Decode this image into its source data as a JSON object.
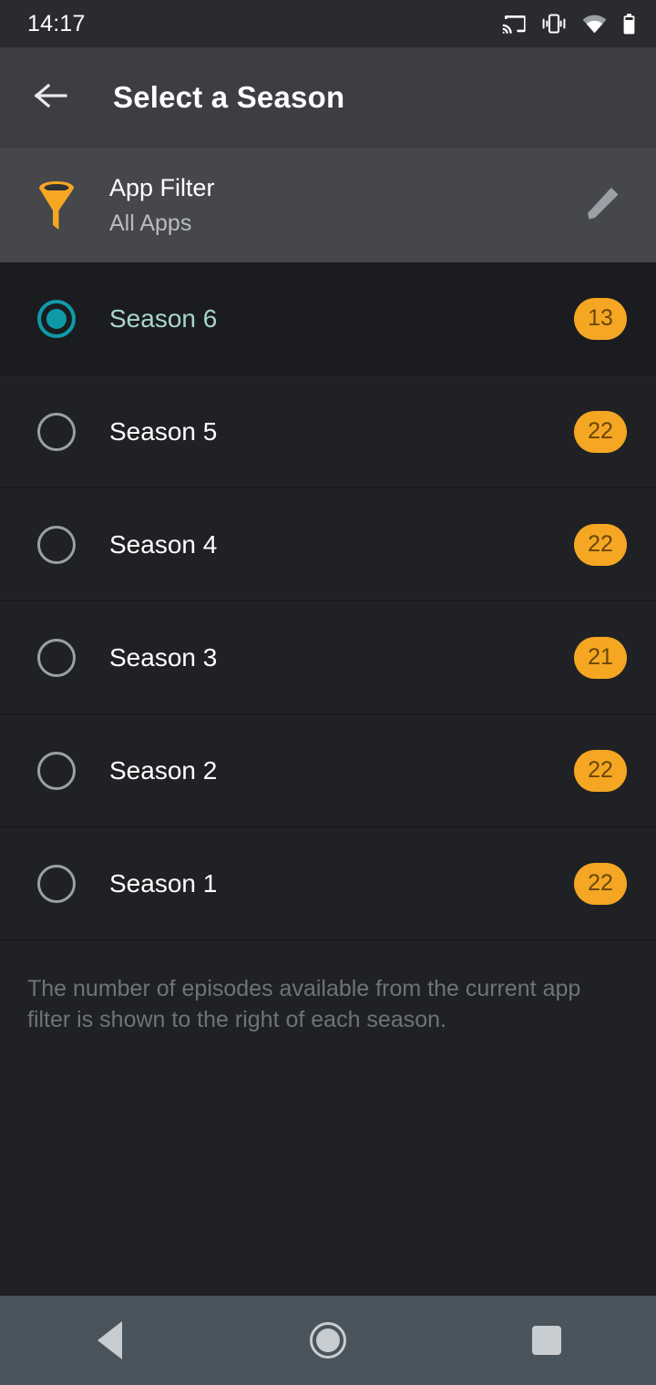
{
  "statusbar": {
    "time": "14:17",
    "icons": [
      "cast-icon",
      "vibrate-icon",
      "wifi-icon",
      "battery-icon"
    ]
  },
  "appbar": {
    "back_label": "back-arrow-icon",
    "title": "Select a Season"
  },
  "filter": {
    "icon": "funnel-icon",
    "title": "App Filter",
    "value": "All Apps",
    "edit_icon": "pencil-icon"
  },
  "seasons": [
    {
      "label": "Season 6",
      "count": "13",
      "selected": true
    },
    {
      "label": "Season 5",
      "count": "22",
      "selected": false
    },
    {
      "label": "Season 4",
      "count": "22",
      "selected": false
    },
    {
      "label": "Season 3",
      "count": "21",
      "selected": false
    },
    {
      "label": "Season 2",
      "count": "22",
      "selected": false
    },
    {
      "label": "Season 1",
      "count": "22",
      "selected": false
    }
  ],
  "note": "The number of episodes available from the current app filter is shown to the right of each season.",
  "navbar": {
    "back": "back-nav-button",
    "home": "home-nav-button",
    "recents": "recents-nav-button"
  },
  "colors": {
    "accent_orange": "#f5a623",
    "accent_teal": "#0f9aa8",
    "selected_text": "#a8d5cc",
    "statusbar_bg": "#2a2b2e",
    "appbar_bg": "#3c3e43",
    "filter_bg": "#45474b",
    "list_bg": "#202124",
    "navbar_bg": "#4a545c"
  }
}
